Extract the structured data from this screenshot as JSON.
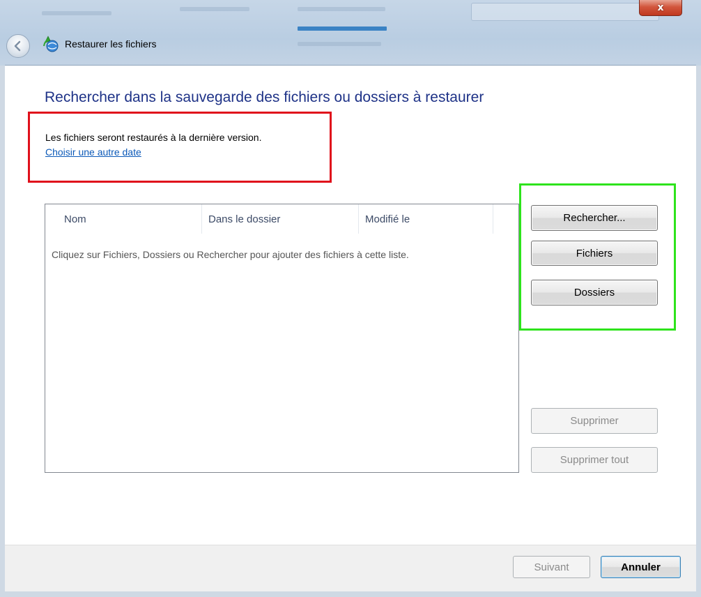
{
  "window": {
    "title": "Restaurer les fichiers",
    "close_label": "x"
  },
  "page": {
    "heading": "Rechercher dans la sauvegarde des fichiers ou dossiers à restaurer",
    "info_text": "Les fichiers seront restaurés à la dernière version.",
    "choose_date_link": "Choisir une autre date"
  },
  "file_list": {
    "columns": [
      "Nom",
      "Dans le dossier",
      "Modifié le"
    ],
    "empty_message": "Cliquez sur Fichiers, Dossiers ou Rechercher pour ajouter des fichiers à cette liste."
  },
  "side_buttons": {
    "search": "Rechercher...",
    "files": "Fichiers",
    "folders": "Dossiers",
    "remove": "Supprimer",
    "remove_all": "Supprimer tout"
  },
  "footer": {
    "next": "Suivant",
    "cancel": "Annuler"
  },
  "colors": {
    "heading": "#1e3287",
    "link": "#0b59b8",
    "highlight_red": "#e0101b",
    "highlight_green": "#2ee31c"
  }
}
